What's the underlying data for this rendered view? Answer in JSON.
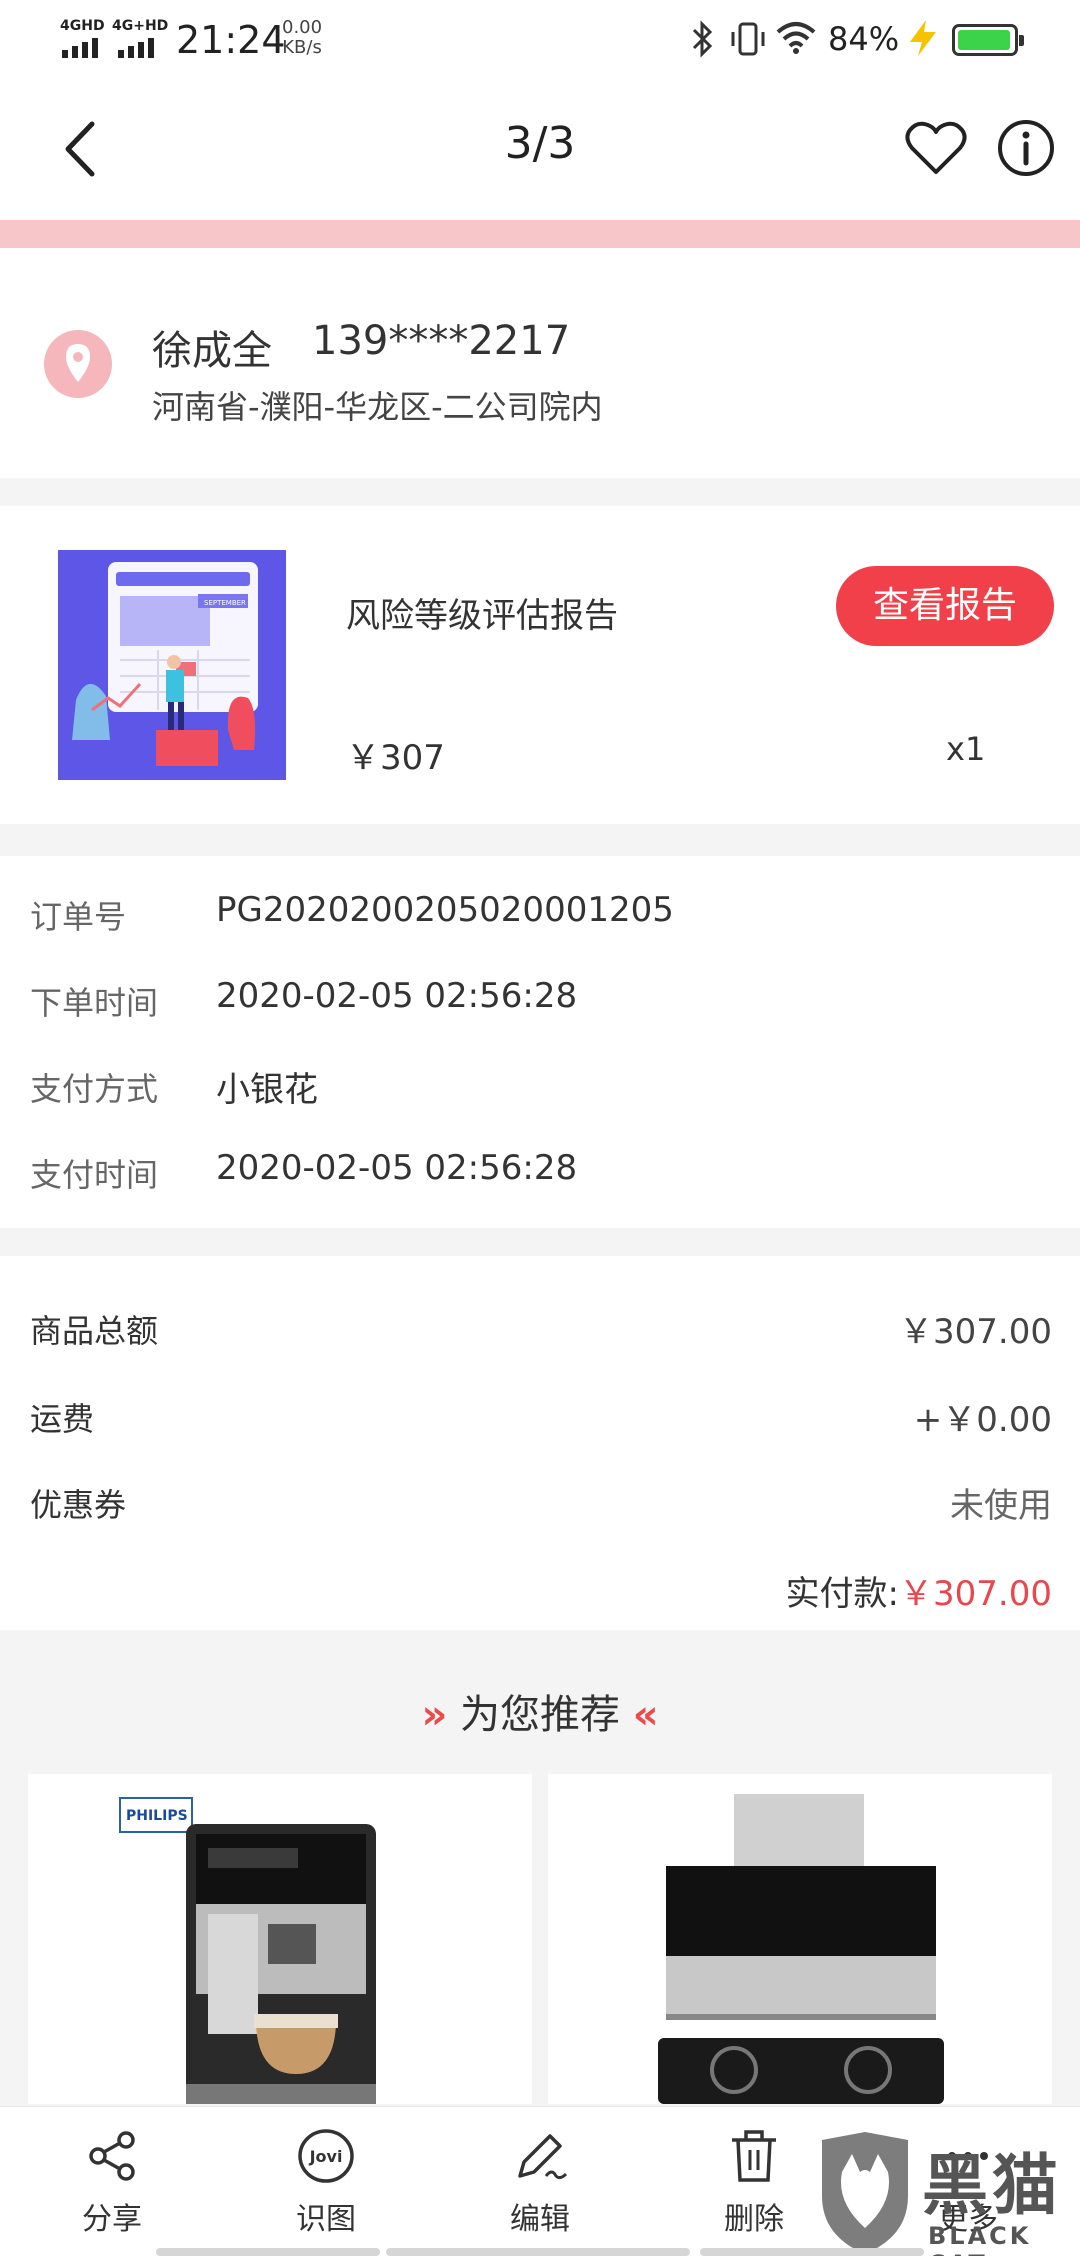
{
  "status_bar": {
    "signal1": "4GHD",
    "signal2": "4G+HD",
    "time": "21:24",
    "speed_value": "0.00",
    "speed_unit": "KB/s",
    "battery_percent": "84%"
  },
  "nav": {
    "title": "3/3",
    "icons": [
      "back-icon",
      "heart-icon",
      "info-icon"
    ]
  },
  "address": {
    "name": "徐成全",
    "phone": "139****2217",
    "detail": "河南省-濮阳-华龙区-二公司院内"
  },
  "product": {
    "title": "风险等级评估报告",
    "price": "￥307",
    "quantity": "x1",
    "report_button": "查看报告",
    "thumbnail_text": "SEPTEMBER"
  },
  "order_info": [
    {
      "label": "订单号",
      "value": "PG2020200205020001205"
    },
    {
      "label": "下单时间",
      "value": "2020-02-05 02:56:28"
    },
    {
      "label": "支付方式",
      "value": "小银花"
    },
    {
      "label": "支付时间",
      "value": "2020-02-05 02:56:28"
    }
  ],
  "amounts": {
    "rows": [
      {
        "label": "商品总额",
        "value": "￥307.00"
      },
      {
        "label": "运费",
        "value": "+￥0.00"
      },
      {
        "label": "优惠券",
        "value": "未使用"
      }
    ],
    "total_label": "实付款:",
    "total_value": "￥307.00"
  },
  "recommend": {
    "title": "为您推荐",
    "left_chevrons": "»",
    "right_chevrons": "«",
    "card1_brand": "PHILIPS"
  },
  "toolbar": {
    "items": [
      {
        "label": "分享",
        "icon": "share-icon"
      },
      {
        "label": "识图",
        "icon": "jovi-icon",
        "badge": "Jovi"
      },
      {
        "label": "编辑",
        "icon": "edit-icon"
      },
      {
        "label": "删除",
        "icon": "trash-icon"
      },
      {
        "label": "更多",
        "icon": "more-icon"
      }
    ]
  },
  "watermark": {
    "cn": "黑猫",
    "en": "BLACK CAT"
  },
  "colors": {
    "accent_red": "#f2404a",
    "price_red": "#e9474e",
    "pink_band": "#f7c6c8",
    "battery_green": "#3cd34b"
  }
}
